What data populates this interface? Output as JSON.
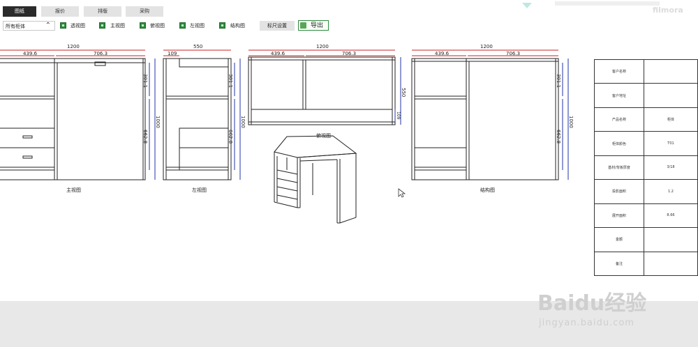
{
  "tabs": [
    {
      "label": "图纸",
      "active": true
    },
    {
      "label": "报价",
      "active": false
    },
    {
      "label": "排版",
      "active": false
    },
    {
      "label": "采购",
      "active": false
    }
  ],
  "toolbar": {
    "cabinet_select": "所有柜体",
    "views": [
      {
        "label": "透视图",
        "checked": true
      },
      {
        "label": "主视图",
        "checked": true
      },
      {
        "label": "俯视图",
        "checked": true
      },
      {
        "label": "左视图",
        "checked": true
      },
      {
        "label": "结构图",
        "checked": true
      }
    ],
    "ruler_settings": "标尺设置",
    "export": "导出"
  },
  "drawings": {
    "front": {
      "caption": "主视图",
      "width": "1200",
      "left": "439.6",
      "right": "706.3",
      "h_top": "301.1",
      "h_bottom": "662.8",
      "h_total": "1000"
    },
    "left": {
      "caption": "左视图",
      "width": "550",
      "sub": "109",
      "h_top": "301.1",
      "h_bottom": "662.8",
      "h_total": "1000"
    },
    "top": {
      "caption": "俯视图",
      "width": "1200",
      "left": "439.6",
      "right": "706.3",
      "h_total": "550",
      "h_small": "109"
    },
    "structure": {
      "caption": "结构图",
      "width": "1200",
      "left": "439.6",
      "right": "706.3",
      "h_top": "301.1",
      "h_bottom": "662.8",
      "h_total": "1000"
    }
  },
  "info_table": [
    {
      "key": "客户名称",
      "value": ""
    },
    {
      "key": "客户地址",
      "value": ""
    },
    {
      "key": "产品名称",
      "value": "柜体"
    },
    {
      "key": "柜体颜色",
      "value": "T01"
    },
    {
      "key": "基材/背板厚度",
      "value": "3/18"
    },
    {
      "key": "投影面积",
      "value": "1.2"
    },
    {
      "key": "展开面积",
      "value": "8.66"
    },
    {
      "key": "金额",
      "value": ""
    },
    {
      "key": "备注",
      "value": ""
    }
  ],
  "watermarks": {
    "filmora": "filmora",
    "baidu": "Baidu经验",
    "baidu_url": "jingyan.baidu.com"
  },
  "colors": {
    "dim_red": "#cc2222",
    "dim_blue": "#2233aa",
    "active_tab": "#2b2b2b",
    "check_green": "#2e8b3e"
  }
}
